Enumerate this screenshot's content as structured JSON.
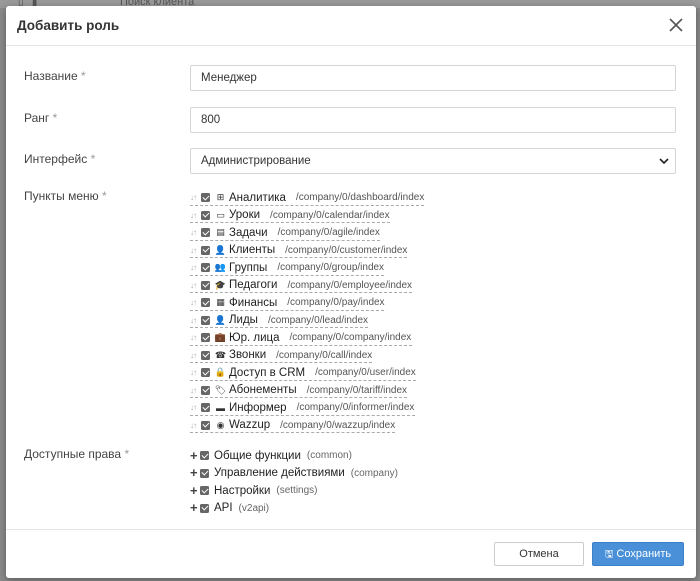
{
  "background": {
    "search_hint": "Поиск клиента"
  },
  "modal": {
    "title": "Добавить роль",
    "fields": {
      "name": {
        "label": "Название",
        "required_mark": "*",
        "value": "Менеджер"
      },
      "rank": {
        "label": "Ранг",
        "required_mark": "*",
        "value": "800"
      },
      "interface": {
        "label": "Интерфейс",
        "required_mark": "*",
        "value": "Администрирование"
      },
      "menu": {
        "label": "Пункты меню",
        "required_mark": "*"
      },
      "rights": {
        "label": "Доступные права",
        "required_mark": "*"
      }
    },
    "menu_items": [
      {
        "icon": "dashboard-icon",
        "label": "Аналитика",
        "path": "/company/0/dashboard/index",
        "checked": true
      },
      {
        "icon": "calendar-icon",
        "label": "Уроки",
        "path": "/company/0/calendar/index",
        "checked": true
      },
      {
        "icon": "tasks-icon",
        "label": "Задачи",
        "path": "/company/0/agile/index",
        "checked": true
      },
      {
        "icon": "user-icon",
        "label": "Клиенты",
        "path": "/company/0/customer/index",
        "checked": true
      },
      {
        "icon": "group-icon",
        "label": "Группы",
        "path": "/company/0/group/index",
        "checked": true
      },
      {
        "icon": "graduation-cap-icon",
        "label": "Педагоги",
        "path": "/company/0/employee/index",
        "checked": true
      },
      {
        "icon": "money-icon",
        "label": "Финансы",
        "path": "/company/0/pay/index",
        "checked": true
      },
      {
        "icon": "lead-user-icon",
        "label": "Лиды",
        "path": "/company/0/lead/index",
        "checked": true
      },
      {
        "icon": "briefcase-icon",
        "label": "Юр. лица",
        "path": "/company/0/company/index",
        "checked": true
      },
      {
        "icon": "phone-icon",
        "label": "Звонки",
        "path": "/company/0/call/index",
        "checked": true
      },
      {
        "icon": "lock-icon",
        "label": "Доступ в CRM",
        "path": "/company/0/user/index",
        "checked": true
      },
      {
        "icon": "tag-icon",
        "label": "Абонементы",
        "path": "/company/0/tariff/index",
        "checked": true
      },
      {
        "icon": "informer-icon",
        "label": "Информер",
        "path": "/company/0/informer/index",
        "checked": true
      },
      {
        "icon": "whatsapp-icon",
        "label": "Wazzup",
        "path": "/company/0/wazzup/index",
        "checked": true
      }
    ],
    "rights_items": [
      {
        "label": "Общие функции",
        "code": "(common)",
        "checked": true
      },
      {
        "label": "Управление действиями",
        "code": "(company)",
        "checked": true
      },
      {
        "label": "Настройки",
        "code": "(settings)",
        "checked": true
      },
      {
        "label": "API",
        "code": "(v2api)",
        "checked": true
      }
    ],
    "buttons": {
      "cancel": "Отмена",
      "save": "Сохранить"
    }
  }
}
